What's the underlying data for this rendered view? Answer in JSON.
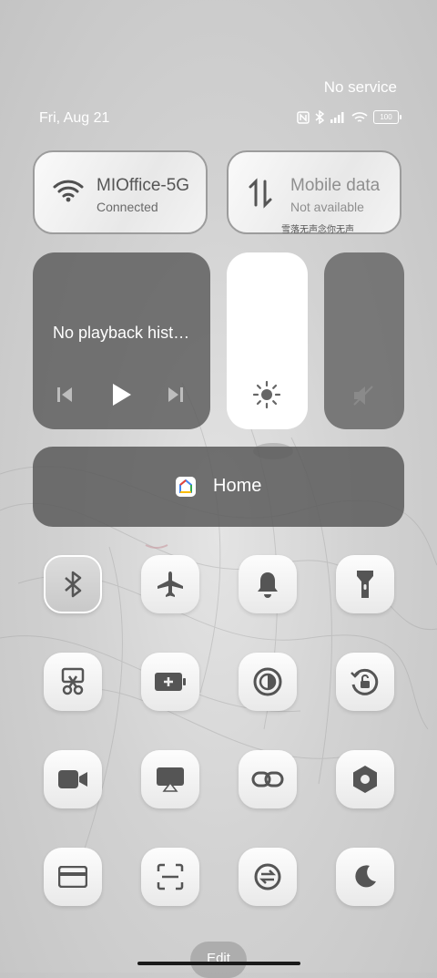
{
  "status_bar": {
    "service": "No service",
    "date": "Fri, Aug 21",
    "battery": "100",
    "icons": [
      "nfc-icon",
      "bluetooth-icon",
      "signal-icon",
      "wifi-icon",
      "battery-icon"
    ]
  },
  "wifi_tile": {
    "title": "MIOffice-5G",
    "subtitle": "Connected"
  },
  "data_tile": {
    "title": "Mobile data",
    "subtitle": "Not available",
    "caption": "雪落无声念你无声"
  },
  "media": {
    "title": "No playback hist…"
  },
  "home_tile": {
    "label": "Home"
  },
  "toggles": [
    {
      "name": "bluetooth",
      "icon": "bluetooth-icon",
      "active": true
    },
    {
      "name": "airplane-mode",
      "icon": "airplane-icon",
      "active": false
    },
    {
      "name": "sound",
      "icon": "bell-icon",
      "active": false
    },
    {
      "name": "flashlight",
      "icon": "flashlight-icon",
      "active": false
    },
    {
      "name": "screenshot",
      "icon": "scissors-icon",
      "active": false
    },
    {
      "name": "battery-saver",
      "icon": "battery-plus-icon",
      "active": false
    },
    {
      "name": "reading-mode",
      "icon": "contrast-icon",
      "active": false
    },
    {
      "name": "rotation-lock",
      "icon": "rotate-lock-icon",
      "active": false
    },
    {
      "name": "screen-recorder",
      "icon": "video-camera-icon",
      "active": false
    },
    {
      "name": "cast",
      "icon": "cast-icon",
      "active": false
    },
    {
      "name": "link",
      "icon": "link-icon",
      "active": false
    },
    {
      "name": "settings",
      "icon": "hexagon-gear-icon",
      "active": false
    },
    {
      "name": "card",
      "icon": "card-icon",
      "active": false
    },
    {
      "name": "scanner",
      "icon": "scan-icon",
      "active": false
    },
    {
      "name": "sync",
      "icon": "sync-icon",
      "active": false
    },
    {
      "name": "dark-mode",
      "icon": "moon-icon",
      "active": false
    }
  ],
  "edit": {
    "label": "Edit"
  },
  "colors": {
    "panel_dark": "#5a5a5a",
    "tile_light": "#f4f4f4",
    "icon": "#555555"
  }
}
